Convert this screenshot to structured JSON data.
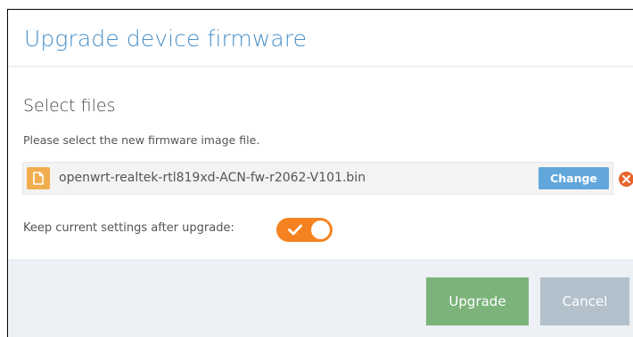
{
  "modal": {
    "title": "Upgrade device firmware"
  },
  "section": {
    "title": "Select files",
    "description": "Please select the new firmware image file."
  },
  "file": {
    "name": "openwrt-realtek-rtl819xd-ACN-fw-r2062-V101.bin",
    "change_label": "Change",
    "icon": "file-icon",
    "remove_icon": "remove-icon"
  },
  "keep_settings": {
    "label": "Keep current settings after upgrade:",
    "enabled": true
  },
  "footer": {
    "upgrade_label": "Upgrade",
    "cancel_label": "Cancel"
  },
  "colors": {
    "title": "#4a90c8",
    "file_icon": "#f0ad4e",
    "change_button": "#62a7dc",
    "remove_icon": "#e8632b",
    "toggle_on": "#f58220",
    "upgrade_button": "#7bb37a",
    "cancel_button": "#b3c1cc",
    "footer_bg": "#edf0f4"
  }
}
